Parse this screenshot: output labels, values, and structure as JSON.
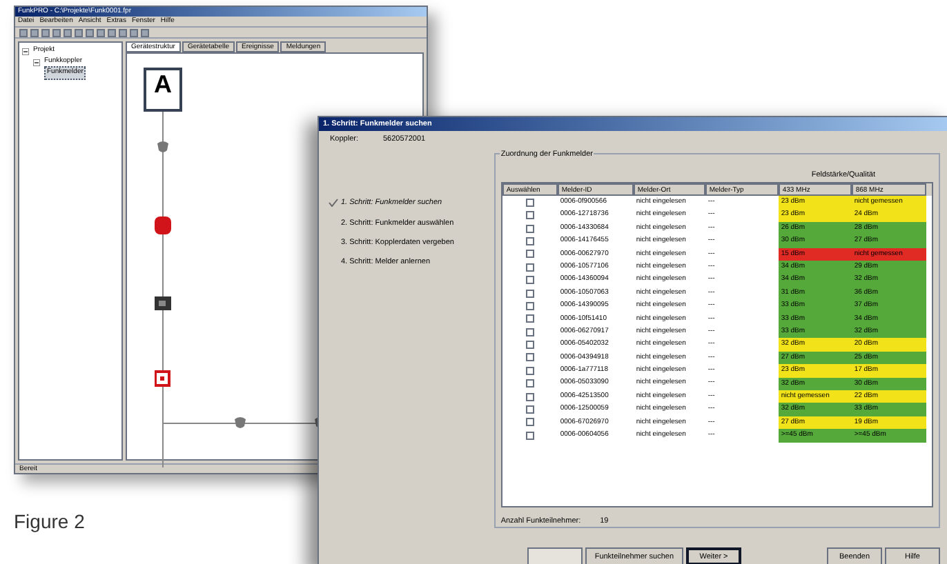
{
  "main_window": {
    "title": "FunkPRO - C:\\Projekte\\Funk0001.fpr",
    "menu": [
      "Datei",
      "Bearbeiten",
      "Ansicht",
      "Extras",
      "Fenster",
      "Hilfe"
    ],
    "tree": [
      {
        "label": "Projekt",
        "expanded": true,
        "children": [
          {
            "label": "Funkkoppler",
            "expanded": true,
            "children": [
              {
                "label": "Funkmelder",
                "selected": true
              }
            ]
          }
        ]
      }
    ],
    "tabs": [
      {
        "label": "Gerätestruktur",
        "selected": true
      },
      {
        "label": "Gerätetabelle",
        "selected": false
      },
      {
        "label": "Ereignisse",
        "selected": false
      },
      {
        "label": "Meldungen",
        "selected": false
      }
    ],
    "diagram": {
      "head_label": "A"
    },
    "status_bar": "Bereit"
  },
  "dialog": {
    "title": "1. Schritt: Funkmelder suchen",
    "coupler_label": "Koppler:",
    "coupler_value": "5620572001",
    "steps": [
      {
        "label": "1. Schritt: Funkmelder suchen",
        "selected": true
      },
      {
        "label": "2. Schritt: Funkmelder auswählen",
        "selected": false
      },
      {
        "label": "3. Schritt: Kopplerdaten vergeben",
        "selected": false
      },
      {
        "label": "4. Schritt: Melder anlernen",
        "selected": false
      }
    ],
    "group_title": "Zuordnung der Funkmelder",
    "band_header": "Feldstärke/Qualität",
    "columns": [
      "Auswählen",
      "Melder-ID",
      "Melder-Ort",
      "Melder-Typ",
      "433 MHz",
      "868 MHz"
    ],
    "rows": [
      {
        "checked": false,
        "id": "0006-0f900566",
        "place": "nicht eingelesen",
        "type": "---",
        "f433": {
          "text": "23 dBm",
          "color": "#f2e21a"
        },
        "f868": {
          "text": "nicht gemessen",
          "color": "#f2e21a"
        }
      },
      {
        "checked": false,
        "id": "0006-12718736",
        "place": "nicht eingelesen",
        "type": "---",
        "f433": {
          "text": "23 dBm",
          "color": "#f2e21a"
        },
        "f868": {
          "text": "24 dBm",
          "color": "#f2e21a"
        }
      },
      {
        "checked": false,
        "id": "0006-14330684",
        "place": "nicht eingelesen",
        "type": "---",
        "f433": {
          "text": "26 dBm",
          "color": "#55a83a"
        },
        "f868": {
          "text": "28 dBm",
          "color": "#55a83a"
        }
      },
      {
        "checked": false,
        "id": "0006-14176455",
        "place": "nicht eingelesen",
        "type": "---",
        "f433": {
          "text": "30 dBm",
          "color": "#55a83a"
        },
        "f868": {
          "text": "27 dBm",
          "color": "#55a83a"
        }
      },
      {
        "checked": false,
        "id": "0006-00627970",
        "place": "nicht eingelesen",
        "type": "---",
        "f433": {
          "text": "15 dBm",
          "color": "#e02a24"
        },
        "f868": {
          "text": "nicht gemessen",
          "color": "#e02a24"
        }
      },
      {
        "checked": false,
        "id": "0006-10577106",
        "place": "nicht eingelesen",
        "type": "---",
        "f433": {
          "text": "34 dBm",
          "color": "#55a83a"
        },
        "f868": {
          "text": "29 dBm",
          "color": "#55a83a"
        }
      },
      {
        "checked": false,
        "id": "0006-14360094",
        "place": "nicht eingelesen",
        "type": "---",
        "f433": {
          "text": "34 dBm",
          "color": "#55a83a"
        },
        "f868": {
          "text": "32 dBm",
          "color": "#55a83a"
        }
      },
      {
        "checked": false,
        "id": "0006-10507063",
        "place": "nicht eingelesen",
        "type": "---",
        "f433": {
          "text": "31 dBm",
          "color": "#55a83a"
        },
        "f868": {
          "text": "36 dBm",
          "color": "#55a83a"
        }
      },
      {
        "checked": false,
        "id": "0006-14390095",
        "place": "nicht eingelesen",
        "type": "---",
        "f433": {
          "text": "33 dBm",
          "color": "#55a83a"
        },
        "f868": {
          "text": "37 dBm",
          "color": "#55a83a"
        }
      },
      {
        "checked": false,
        "id": "0006-10f51410",
        "place": "nicht eingelesen",
        "type": "---",
        "f433": {
          "text": "33 dBm",
          "color": "#55a83a"
        },
        "f868": {
          "text": "34 dBm",
          "color": "#55a83a"
        }
      },
      {
        "checked": false,
        "id": "0006-06270917",
        "place": "nicht eingelesen",
        "type": "---",
        "f433": {
          "text": "33 dBm",
          "color": "#55a83a"
        },
        "f868": {
          "text": "32 dBm",
          "color": "#55a83a"
        }
      },
      {
        "checked": false,
        "id": "0006-05402032",
        "place": "nicht eingelesen",
        "type": "---",
        "f433": {
          "text": "32 dBm",
          "color": "#f2e21a"
        },
        "f868": {
          "text": "20 dBm",
          "color": "#f2e21a"
        }
      },
      {
        "checked": false,
        "id": "0006-04394918",
        "place": "nicht eingelesen",
        "type": "---",
        "f433": {
          "text": "27 dBm",
          "color": "#55a83a"
        },
        "f868": {
          "text": "25 dBm",
          "color": "#55a83a"
        }
      },
      {
        "checked": false,
        "id": "0006-1a777118",
        "place": "nicht eingelesen",
        "type": "---",
        "f433": {
          "text": "23 dBm",
          "color": "#f2e21a"
        },
        "f868": {
          "text": "17 dBm",
          "color": "#f2e21a"
        }
      },
      {
        "checked": false,
        "id": "0006-05033090",
        "place": "nicht eingelesen",
        "type": "---",
        "f433": {
          "text": "32 dBm",
          "color": "#55a83a"
        },
        "f868": {
          "text": "30 dBm",
          "color": "#55a83a"
        }
      },
      {
        "checked": false,
        "id": "0006-42513500",
        "place": "nicht eingelesen",
        "type": "---",
        "f433": {
          "text": "nicht gemessen",
          "color": "#f2e21a"
        },
        "f868": {
          "text": "22 dBm",
          "color": "#f2e21a"
        }
      },
      {
        "checked": false,
        "id": "0006-12500059",
        "place": "nicht eingelesen",
        "type": "---",
        "f433": {
          "text": "32 dBm",
          "color": "#55a83a"
        },
        "f868": {
          "text": "33 dBm",
          "color": "#55a83a"
        }
      },
      {
        "checked": false,
        "id": "0006-67026970",
        "place": "nicht eingelesen",
        "type": "---",
        "f433": {
          "text": "27 dBm",
          "color": "#f2e21a"
        },
        "f868": {
          "text": "19 dBm",
          "color": "#f2e21a"
        }
      },
      {
        "checked": false,
        "id": "0006-00604056",
        "place": "nicht eingelesen",
        "type": "---",
        "f433": {
          "text": ">=45 dBm",
          "color": "#55a83a"
        },
        "f868": {
          "text": ">=45 dBm",
          "color": "#55a83a"
        }
      }
    ],
    "count_label": "Anzahl Funkteilnehmer:",
    "count_value": "19",
    "buttons": [
      {
        "disabled": true
      },
      {
        "label": "Funkteilnehmer suchen",
        "disabled": false
      },
      {
        "label": "Weiter >",
        "disabled": false,
        "default": true
      },
      {
        "label": "Beenden",
        "disabled": false
      },
      {
        "label": "Hilfe",
        "disabled": false
      }
    ]
  },
  "caption": "Figure 2"
}
